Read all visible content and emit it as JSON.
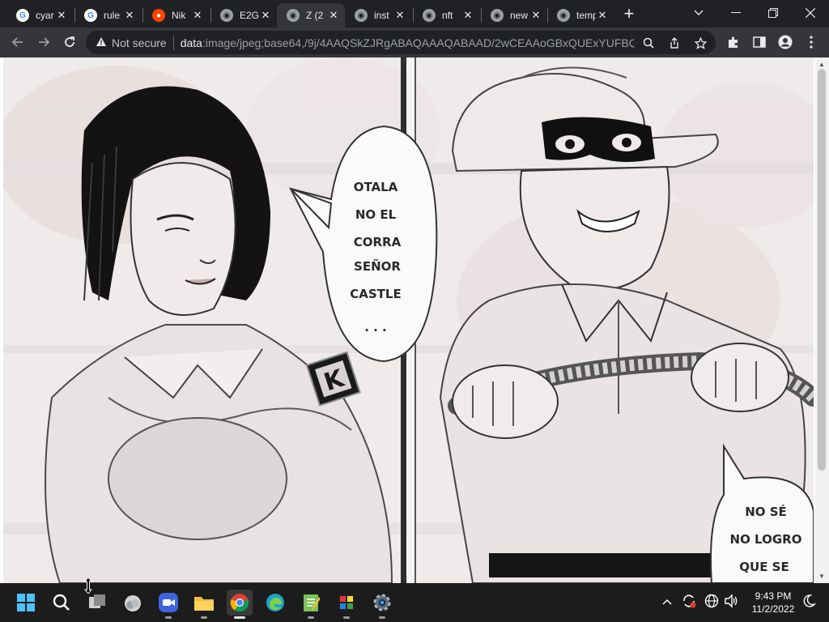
{
  "tabs": [
    {
      "label": "cyar",
      "favicon": "google-icon"
    },
    {
      "label": "rule",
      "favicon": "google-icon"
    },
    {
      "label": "Nik",
      "favicon": "reddit-icon"
    },
    {
      "label": "E2G",
      "favicon": "globe-icon"
    },
    {
      "label": "Z (2",
      "favicon": "globe-icon",
      "active": true
    },
    {
      "label": "inst",
      "favicon": "globe-icon"
    },
    {
      "label": "nft",
      "favicon": "globe-icon"
    },
    {
      "label": "new",
      "favicon": "globe-icon"
    },
    {
      "label": "templat",
      "favicon": "globe-icon"
    }
  ],
  "toolbar": {
    "security_label": "Not secure",
    "url_scheme": "data",
    "url_rest": ":image/jpeg;base64,/9j/4AAQSkZJRgABAQAAAQABAAD/2wCEAAoGBxQUExYUFBQY..."
  },
  "manga": {
    "speech_left": [
      "OTALA",
      "NO EL",
      "CORRA",
      "SEÑOR",
      "CASTLE",
      ". . ."
    ],
    "speech_right": [
      "NO SÉ",
      "NO LOGRO",
      "QUE SE"
    ],
    "badge": "K"
  },
  "taskbar": {
    "apps": [
      "windows-start-icon",
      "search-icon",
      "task-view-icon",
      "weather-icon",
      "zoom-icon",
      "file-explorer-icon",
      "chrome-icon",
      "edge-icon",
      "notepad-icon",
      "photos-icon",
      "settings-icon"
    ]
  },
  "clock": {
    "time": "9:43 PM",
    "date": "11/2/2022"
  },
  "colors": {
    "tabstrip": "#202124",
    "toolbar": "#35363a",
    "taskbar": "#1c1c1c"
  }
}
